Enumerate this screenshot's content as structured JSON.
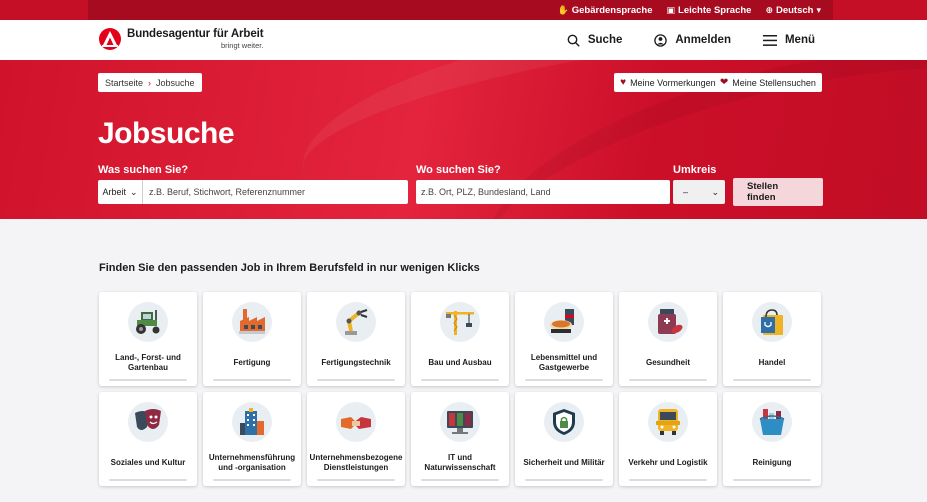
{
  "utility": {
    "sign_language": "Gebärdensprache",
    "easy_language": "Leichte Sprache",
    "language": "Deutsch"
  },
  "header": {
    "logo_name": "Bundesagentur für Arbeit",
    "logo_tagline": "bringt weiter.",
    "nav": {
      "search": "Suche",
      "login": "Anmelden",
      "menu": "Menü"
    }
  },
  "hero": {
    "breadcrumb": [
      "Startseite",
      "Jobsuche"
    ],
    "bookmarks": "Meine Vormerkungen",
    "saved_searches": "Meine Stellensuchen",
    "title": "Jobsuche",
    "what_label": "Was suchen Sie?",
    "what_type": "Arbeit",
    "what_placeholder": "z.B. Beruf, Stichwort, Referenznummer",
    "where_label": "Wo suchen Sie?",
    "where_placeholder": "z.B. Ort, PLZ, Bundesland, Land",
    "radius_label": "Umkreis",
    "radius_value": "–",
    "submit": "Stellen finden"
  },
  "main": {
    "section_title": "Finden Sie den passenden Job in Ihrem Berufsfeld in nur wenigen Klicks",
    "fields": [
      {
        "label": "Land-, Forst- und Gartenbau",
        "icon": "tractor-icon"
      },
      {
        "label": "Fertigung",
        "icon": "factory-icon"
      },
      {
        "label": "Fertigungstechnik",
        "icon": "robot-arm-icon"
      },
      {
        "label": "Bau und Ausbau",
        "icon": "crane-icon"
      },
      {
        "label": "Lebensmittel und Gastgewerbe",
        "icon": "food-icon"
      },
      {
        "label": "Gesundheit",
        "icon": "medicine-icon"
      },
      {
        "label": "Handel",
        "icon": "shopping-bag-icon"
      },
      {
        "label": "Soziales und Kultur",
        "icon": "theater-masks-icon"
      },
      {
        "label": "Unternehmensführung und -organisation",
        "icon": "office-building-icon"
      },
      {
        "label": "Unternehmensbezogene Dienstleistungen",
        "icon": "handshake-icon"
      },
      {
        "label": "IT und Naturwissenschaft",
        "icon": "monitor-icon"
      },
      {
        "label": "Sicherheit und Militär",
        "icon": "shield-lock-icon"
      },
      {
        "label": "Verkehr und Logistik",
        "icon": "bus-icon"
      },
      {
        "label": "Reinigung",
        "icon": "cleaning-bucket-icon"
      }
    ]
  },
  "colors": {
    "brand_red": "#e2001a",
    "hero_red": "#d0122b",
    "dark_red": "#a70b20"
  }
}
